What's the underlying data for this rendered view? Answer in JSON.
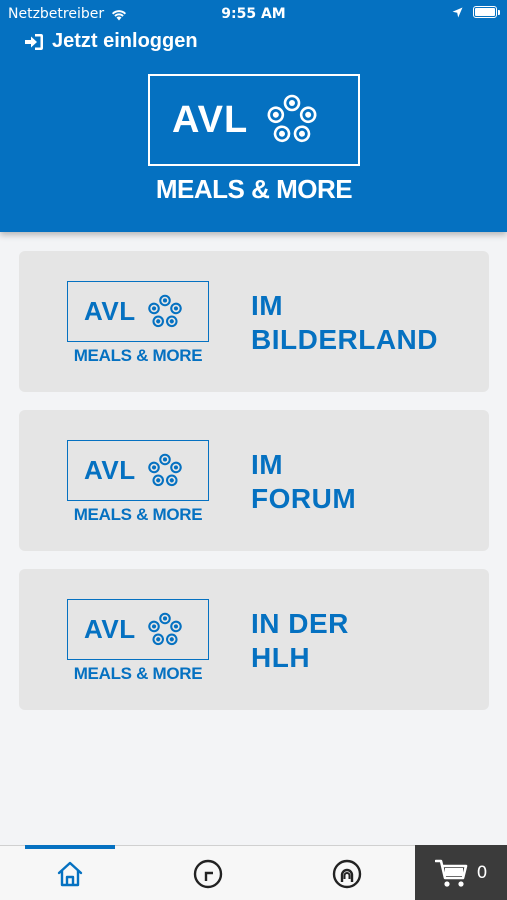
{
  "status_bar": {
    "carrier": "Netzbetreiber",
    "time": "9:55 AM"
  },
  "header": {
    "login_label": "Jetzt einloggen",
    "logo_text": "AVL",
    "logo_subtitle": "MEALS & MORE",
    "background_color": "#0571c1"
  },
  "locations": [
    {
      "logo_text": "AVL",
      "logo_subtitle": "MEALS & MORE",
      "title_line1": "IM",
      "title_line2": "BILDERLAND"
    },
    {
      "logo_text": "AVL",
      "logo_subtitle": "MEALS & MORE",
      "title_line1": "IM",
      "title_line2": "FORUM"
    },
    {
      "logo_text": "AVL",
      "logo_subtitle": "MEALS & MORE",
      "title_line1": "IN DER",
      "title_line2": "HLH"
    }
  ],
  "tab_bar": {
    "tabs": [
      {
        "icon": "home-icon",
        "active": true
      },
      {
        "icon": "history-icon",
        "active": false
      },
      {
        "icon": "profile-icon",
        "active": false
      }
    ],
    "cart_count": "0"
  }
}
